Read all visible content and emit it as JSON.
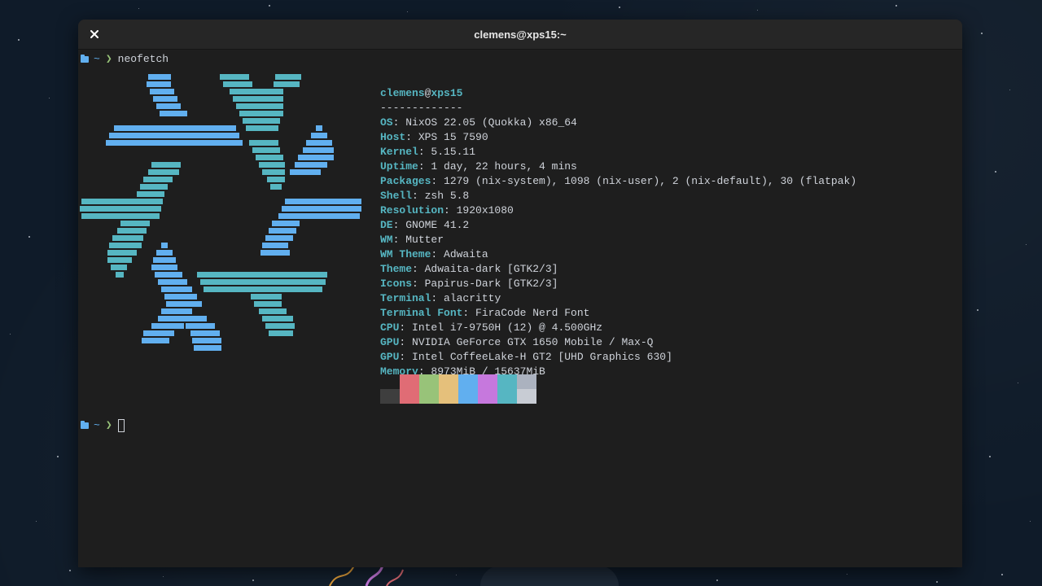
{
  "window": {
    "title": "clemens@xps15:~"
  },
  "prompt": {
    "dir": "~",
    "arrow": "❯",
    "command": "neofetch"
  },
  "prompt2": {
    "dir": "~",
    "arrow": "❯"
  },
  "neofetch": {
    "user": "clemens",
    "at": "@",
    "host": "xps15",
    "separator": "-------------",
    "fields": [
      {
        "key": "OS",
        "value": "NixOS 22.05 (Quokka) x86_64"
      },
      {
        "key": "Host",
        "value": "XPS 15 7590"
      },
      {
        "key": "Kernel",
        "value": "5.15.11"
      },
      {
        "key": "Uptime",
        "value": "1 day, 22 hours, 4 mins"
      },
      {
        "key": "Packages",
        "value": "1279 (nix-system), 1098 (nix-user), 2 (nix-default), 30 (flatpak)"
      },
      {
        "key": "Shell",
        "value": "zsh 5.8"
      },
      {
        "key": "Resolution",
        "value": "1920x1080"
      },
      {
        "key": "DE",
        "value": "GNOME 41.2"
      },
      {
        "key": "WM",
        "value": "Mutter"
      },
      {
        "key": "WM Theme",
        "value": "Adwaita"
      },
      {
        "key": "Theme",
        "value": "Adwaita-dark [GTK2/3]"
      },
      {
        "key": "Icons",
        "value": "Papirus-Dark [GTK2/3]"
      },
      {
        "key": "Terminal",
        "value": "alacritty"
      },
      {
        "key": "Terminal Font",
        "value": "FiraCode Nerd Font"
      },
      {
        "key": "CPU",
        "value": "Intel i7-9750H (12) @ 4.500GHz"
      },
      {
        "key": "GPU",
        "value": "NVIDIA GeForce GTX 1650 Mobile / Max-Q"
      },
      {
        "key": "GPU",
        "value": "Intel CoffeeLake-H GT2 [UHD Graphics 630]"
      },
      {
        "key": "Memory",
        "value": "8973MiB / 15637MiB"
      }
    ],
    "palette_top": [
      "#1e1e1e",
      "#e06c75",
      "#98c379",
      "#e5c07b",
      "#61afef",
      "#c678dd",
      "#56b6c2",
      "#abb2bf"
    ],
    "palette_bottom": [
      "#3e3e3e",
      "#e06c75",
      "#98c379",
      "#e5c07b",
      "#61afef",
      "#c678dd",
      "#56b6c2",
      "#c8ccd4"
    ]
  },
  "colors": {
    "blue": "#61afef",
    "cyan": "#56b6c2",
    "green": "#98c379",
    "text": "#cfd3da"
  },
  "icons": {
    "close": "close-icon",
    "folder": "folder-icon"
  }
}
